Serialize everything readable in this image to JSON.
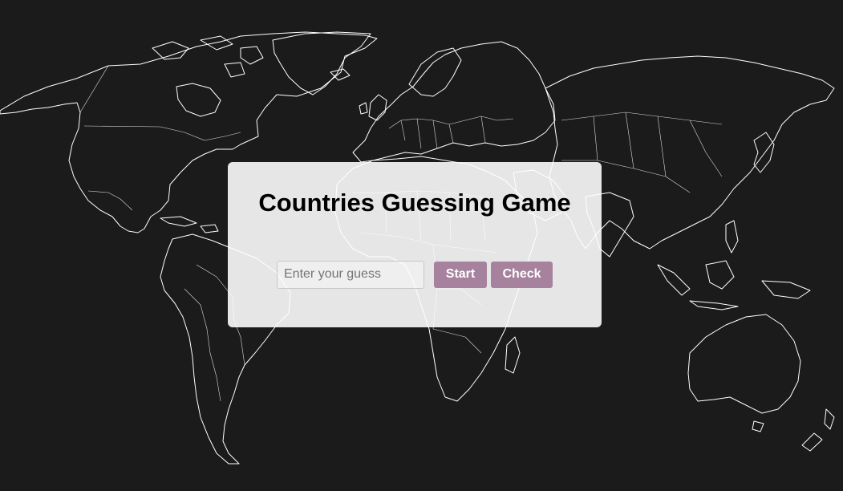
{
  "game": {
    "title": "Countries Guessing Game",
    "guess_input": {
      "value": "",
      "placeholder": "Enter your guess"
    },
    "start_label": "Start",
    "check_label": "Check"
  },
  "colors": {
    "background": "#1b1b1b",
    "map_lines": "#ffffff",
    "panel": "#e9e9e9",
    "button": "#a6829e"
  },
  "icons": [
    "world-map"
  ]
}
